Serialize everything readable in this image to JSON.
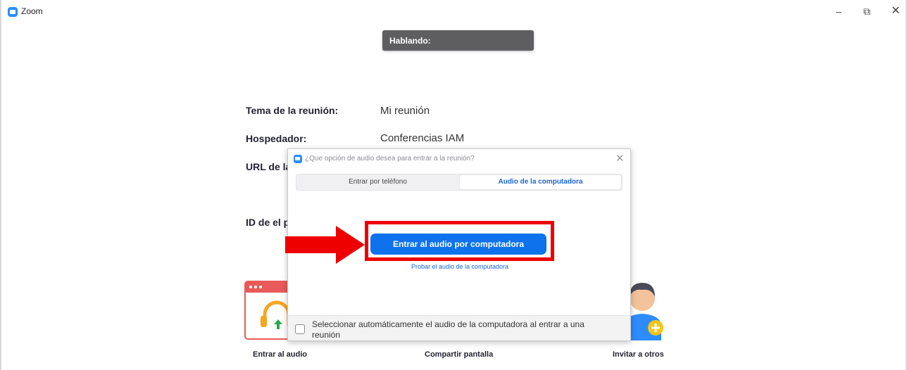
{
  "window": {
    "app_title": "Zoom",
    "controls": {
      "minimize": "–",
      "restore": "⧉",
      "close": "✕"
    }
  },
  "speaking_indicator": "Hablando:",
  "meeting_info": {
    "topic_label": "Tema de la reunión:",
    "topic_value": "Mi reunión",
    "host_label": "Hospedador:",
    "host_value": "Conferencias IAM",
    "url_label": "URL de la",
    "id_label": "ID de el p"
  },
  "bottom_actions": {
    "join_audio": "Entrar al audio",
    "share_screen": "Compartir pantalla",
    "invite": "Invitar a otros"
  },
  "audio_dialog": {
    "title": "¿Que opción de audio desea para entrar a la reunión?",
    "close": "✕",
    "tabs": [
      {
        "label": "Entrar por teléfono",
        "selected": false
      },
      {
        "label": "Audio de la computadora",
        "selected": true
      }
    ],
    "join_button": "Entrar al audio por computadora",
    "test_link": "Probar el audio de la computadora",
    "auto_select": {
      "label": "Seleccionar automáticamente el audio de la computadora al entrar a una reunión",
      "checked": false
    }
  },
  "colors": {
    "accent": "#0e72ed",
    "annotation_red": "#ef0000",
    "speaking_bg": "#5e5e61"
  }
}
